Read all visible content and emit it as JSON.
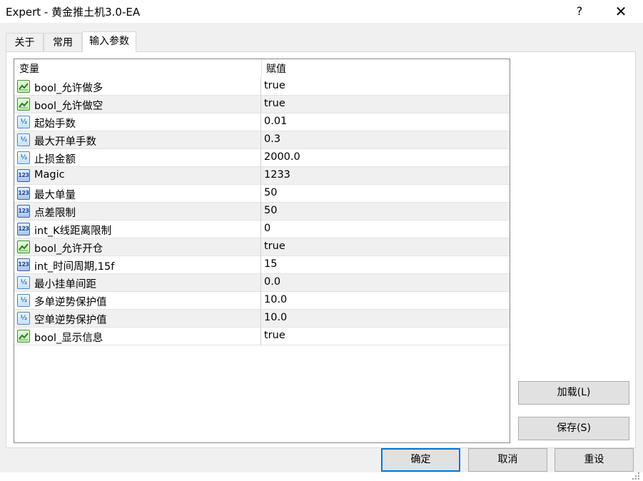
{
  "window": {
    "title": "Expert - 黄金推土机3.0-EA",
    "help_label": "?",
    "close_label": "✕"
  },
  "tabs": [
    {
      "label": "关于"
    },
    {
      "label": "常用"
    },
    {
      "label": "输入参数",
      "active": true
    }
  ],
  "grid": {
    "columns": [
      "变量",
      "赋值"
    ],
    "rows": [
      {
        "name": "bool_允许做多",
        "value": "true",
        "type": "bool-icon"
      },
      {
        "name": "bool_允许做空",
        "value": "true",
        "type": "bool-icon"
      },
      {
        "name": "起始手数",
        "value": "0.01",
        "type": "double-icon"
      },
      {
        "name": "最大开单手数",
        "value": "0.3",
        "type": "double-icon"
      },
      {
        "name": "止损金额",
        "value": "2000.0",
        "type": "double-icon"
      },
      {
        "name": "Magic",
        "value": "1233",
        "type": "int-icon"
      },
      {
        "name": "最大单量",
        "value": "50",
        "type": "int-icon"
      },
      {
        "name": "点差限制",
        "value": "50",
        "type": "int-icon"
      },
      {
        "name": "int_K线距离限制",
        "value": "0",
        "type": "int-icon"
      },
      {
        "name": "bool_允许开仓",
        "value": "true",
        "type": "bool-icon"
      },
      {
        "name": "int_时间周期,15f",
        "value": "15",
        "type": "int-icon"
      },
      {
        "name": "最小挂单间距",
        "value": "0.0",
        "type": "double-icon"
      },
      {
        "name": "多单逆势保护值",
        "value": "10.0",
        "type": "double-icon"
      },
      {
        "name": "空单逆势保护值",
        "value": "10.0",
        "type": "double-icon"
      },
      {
        "name": "bool_显示信息",
        "value": "true",
        "type": "bool-icon"
      }
    ]
  },
  "icon_text": {
    "double": "½",
    "int": "123"
  },
  "side_buttons": {
    "load": "加载(L)",
    "save": "保存(S)"
  },
  "footer_buttons": {
    "ok": "确定",
    "cancel": "取消",
    "reset": "重设"
  },
  "colors": {
    "default_button_border": "#0078d7",
    "bool_icon": "#3c9a2c",
    "double_icon": "#4d8cc7",
    "int_icon": "#3566a8"
  }
}
